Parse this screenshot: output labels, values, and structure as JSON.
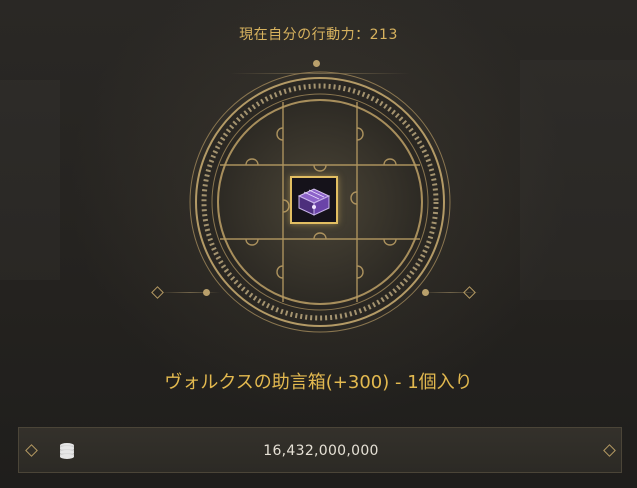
{
  "header": {
    "action_power_label": "現在自分の行動力：213"
  },
  "reward": {
    "item_name": "ヴォルクスの助言箱(+300) - 1個入り",
    "item_icon": "purple-treasure-chest-icon"
  },
  "currency": {
    "amount": "16,432,000,000",
    "icon": "silver-coin-stack-icon"
  },
  "colors": {
    "accent_gold": "#d7b25e",
    "item_name_gold": "#e3b94f",
    "background": "#24221f"
  }
}
